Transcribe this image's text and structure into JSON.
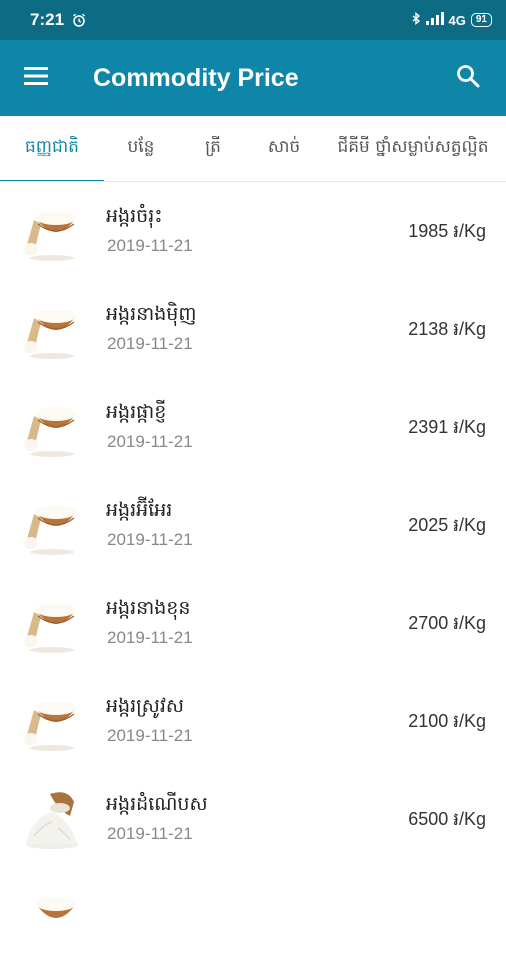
{
  "status": {
    "time": "7:21",
    "network": "4G",
    "battery": "91"
  },
  "app": {
    "title": "Commodity Price"
  },
  "tabs": [
    {
      "label": "ធញ្ញជាតិ"
    },
    {
      "label": "បន្លែ"
    },
    {
      "label": "ត្រី"
    },
    {
      "label": "សាច់"
    },
    {
      "label": "ជីគីមី ថ្នាំសម្លាប់សត្វល្អិត"
    }
  ],
  "items": [
    {
      "name": "អង្ករចំរុះ",
      "date": "2019-11-21",
      "price": "1985 ៛/Kg",
      "icon": "rice-bowl-icon"
    },
    {
      "name": "អង្ករនាងម៉ិញ",
      "date": "2019-11-21",
      "price": "2138 ៛/Kg",
      "icon": "rice-bowl-icon"
    },
    {
      "name": "អង្ករផ្កាខ្ញី",
      "date": "2019-11-21",
      "price": "2391 ៛/Kg",
      "icon": "rice-bowl-icon"
    },
    {
      "name": "អង្ករអ៊ីអែរ",
      "date": "2019-11-21",
      "price": "2025 ៛/Kg",
      "icon": "rice-bowl-icon"
    },
    {
      "name": "អង្ករនាងខុន",
      "date": "2019-11-21",
      "price": "2700 ៛/Kg",
      "icon": "rice-bowl-icon"
    },
    {
      "name": "អង្ករស្រូវស",
      "date": "2019-11-21",
      "price": "2100 ៛/Kg",
      "icon": "rice-bowl-icon"
    },
    {
      "name": "អង្ករដំណើបស",
      "date": "2019-11-21",
      "price": "6500 ៛/Kg",
      "icon": "rice-pile-icon"
    }
  ],
  "colors": {
    "app_bar": "#0f86a7",
    "status_bar": "#0d6b84",
    "accent": "#0f86a7"
  }
}
